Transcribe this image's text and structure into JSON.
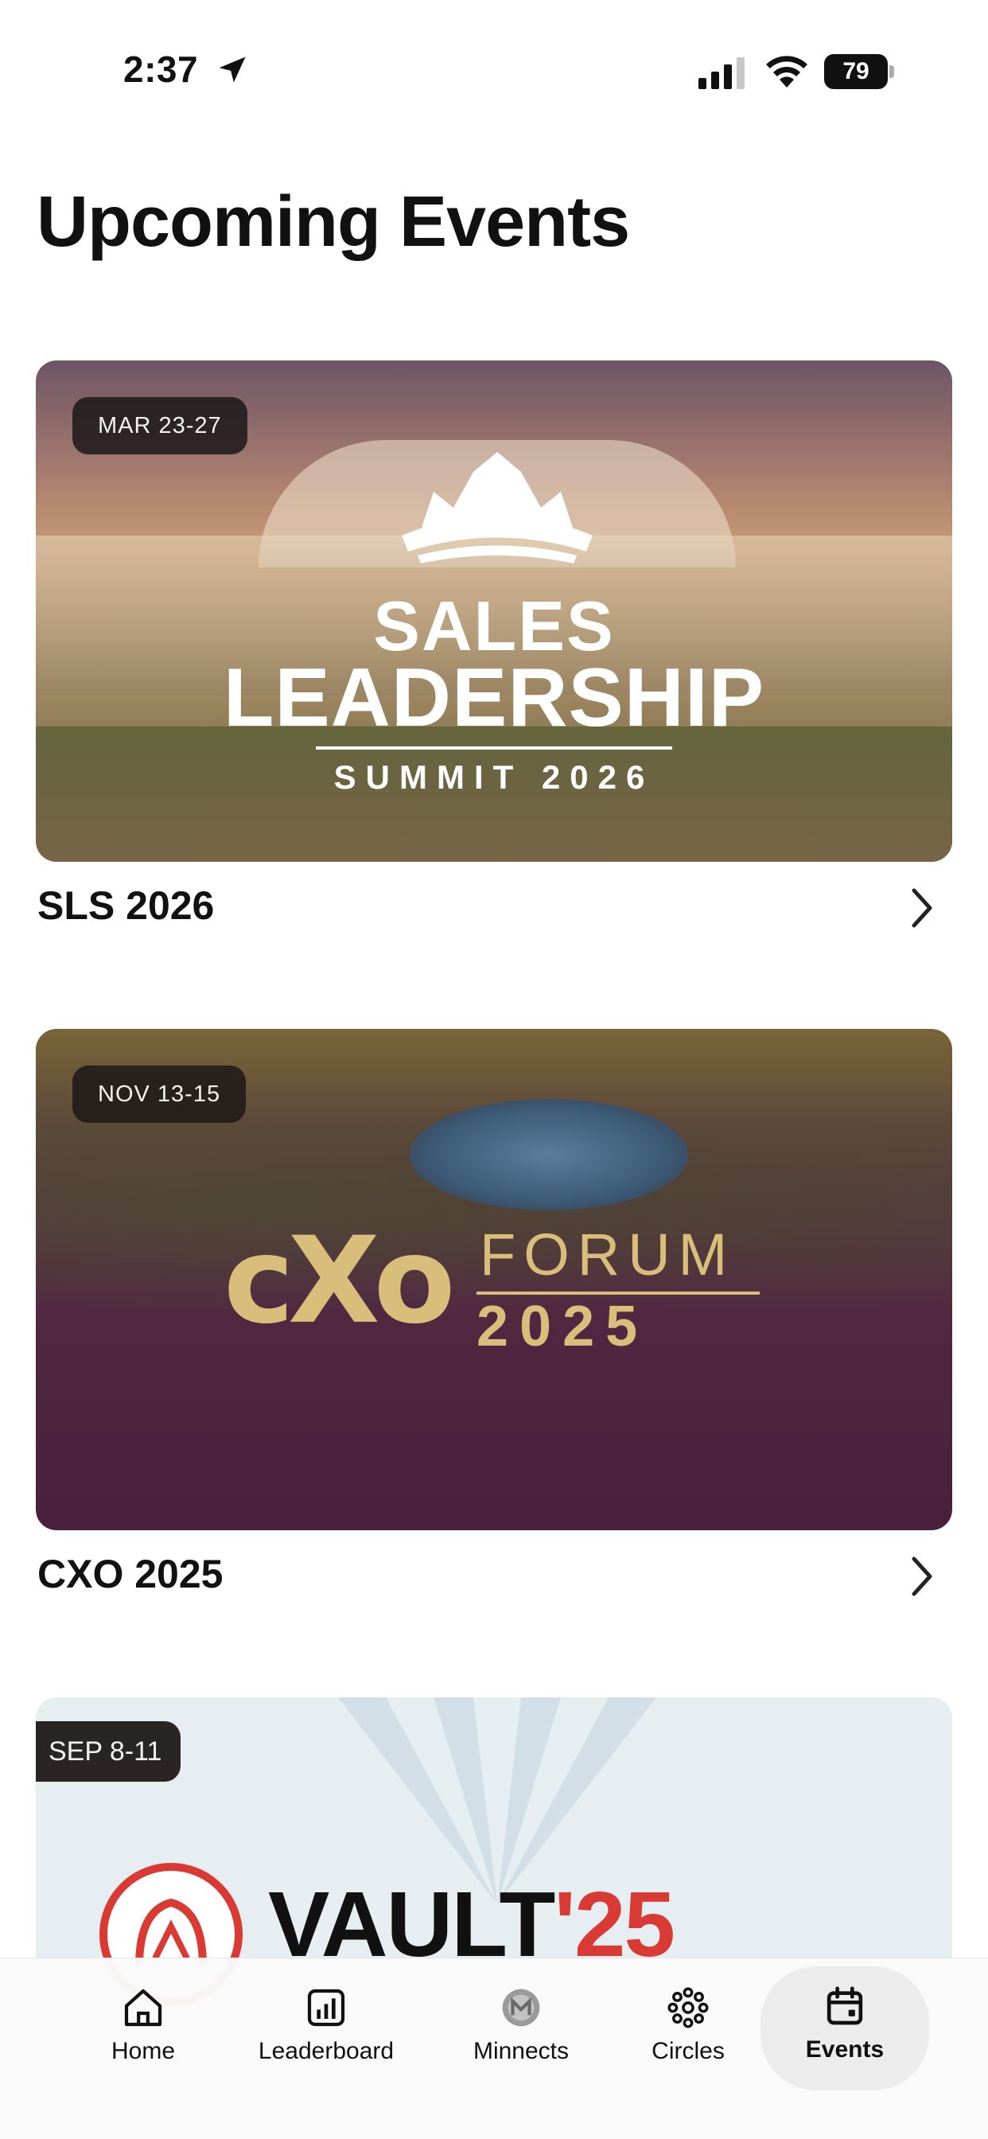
{
  "status_bar": {
    "time": "2:37",
    "battery": "79"
  },
  "page": {
    "title": "Upcoming Events"
  },
  "events": [
    {
      "date": "MAR 23-27",
      "name": "SLS 2026",
      "image_text": {
        "line1": "SALES",
        "line2": "LEADERSHIP",
        "line3": "SUMMIT 2026"
      }
    },
    {
      "date": "NOV 13-15",
      "name": "CXO 2025",
      "image_text": {
        "mark": "cXo",
        "word": "FORUM",
        "year": "2025"
      }
    },
    {
      "date": "SEP 8-11",
      "name": "",
      "image_text": {
        "word": "VAULT",
        "year": "'25"
      }
    }
  ],
  "tabs": [
    {
      "label": "Home",
      "icon": "home-icon"
    },
    {
      "label": "Leaderboard",
      "icon": "leaderboard-icon"
    },
    {
      "label": "Minnects",
      "icon": "minnects-icon"
    },
    {
      "label": "Circles",
      "icon": "circles-icon"
    },
    {
      "label": "Events",
      "icon": "calendar-icon",
      "active": true
    }
  ],
  "colors": {
    "accent_gold": "#d9bd7a",
    "cxo_purple": "#48203c",
    "vault_red": "#d93a33",
    "tab_active_bg": "#ececec"
  }
}
